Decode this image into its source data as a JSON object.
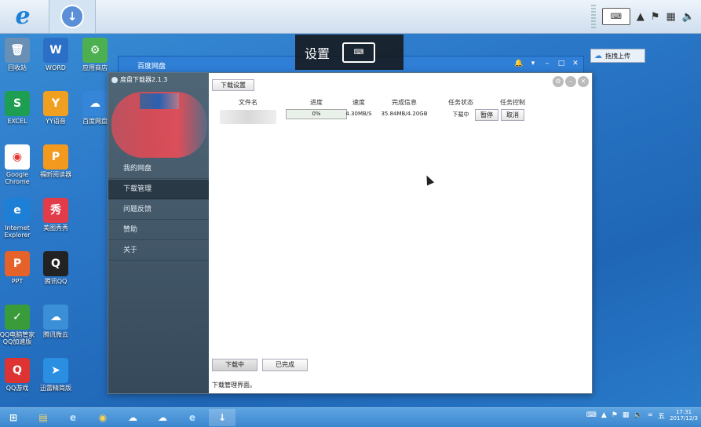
{
  "top_bar": {
    "keyboard_label": "⌨",
    "tray_icons": [
      "arrow-up-icon",
      "flag-icon",
      "network-icon",
      "volume-icon"
    ]
  },
  "desktop_icons": [
    {
      "label": "回收站",
      "glyph": "🗑",
      "color": "#6a8fb5"
    },
    {
      "label": "WORD",
      "glyph": "W",
      "color": "#2b6fc7"
    },
    {
      "label": "应用商店",
      "glyph": "⚙",
      "color": "#4caf50"
    },
    {
      "label": "EXCEL",
      "glyph": "S",
      "color": "#1e9e52"
    },
    {
      "label": "YY语音",
      "glyph": "Y",
      "color": "#f0a020"
    },
    {
      "label": "百度网盘",
      "glyph": "☁",
      "color": "#3585d8"
    },
    {
      "label": "Google Chrome",
      "glyph": "◉",
      "color": "#ffffff"
    },
    {
      "label": "福昕阅读器",
      "glyph": "P",
      "color": "#f39a1e"
    },
    {
      "label": "Internet Explorer",
      "glyph": "e",
      "color": "#1d7fd6"
    },
    {
      "label": "美图秀秀",
      "glyph": "秀",
      "color": "#e23c4a"
    },
    {
      "label": "PPT",
      "glyph": "P",
      "color": "#e5622b"
    },
    {
      "label": "腾讯QQ",
      "glyph": "Q",
      "color": "#222222"
    },
    {
      "label": "QQ电脑管家 QQ加速版",
      "glyph": "✓",
      "color": "#3a9b3a"
    },
    {
      "label": "腾讯微云",
      "glyph": "☁",
      "color": "#3a8fd6"
    },
    {
      "label": "QQ游戏",
      "glyph": "Q",
      "color": "#d33"
    },
    {
      "label": "迅雷精简版",
      "glyph": "➤",
      "color": "#2a8fe0"
    }
  ],
  "baidu_window": {
    "title": "百度网盘",
    "drag_upload": "拖拽上传"
  },
  "osd": {
    "label": "设置"
  },
  "downloader": {
    "title": "度盘下载器2.1.3",
    "nav": [
      {
        "label": "我的网盘"
      },
      {
        "label": "下载管理"
      },
      {
        "label": "问题反馈"
      },
      {
        "label": "赞助"
      },
      {
        "label": "关于"
      }
    ],
    "settings_button": "下载设置",
    "columns": [
      "文件名",
      "进度",
      "速度",
      "完成信息",
      "任务状态",
      "任务控制"
    ],
    "task": {
      "progress": "0%",
      "progress_value": 0,
      "speed": "4.30MB/S",
      "completed": "35.84MB/4.20GB",
      "status": "下载中",
      "pause": "暂停",
      "cancel": "取消"
    },
    "tabs": {
      "downloading": "下载中",
      "completed": "已完成"
    },
    "status_line": "下载管理界面。"
  },
  "clock": {
    "time": "17:31",
    "date": "2017/12/3"
  },
  "tray_text": {
    "lang": "五"
  }
}
